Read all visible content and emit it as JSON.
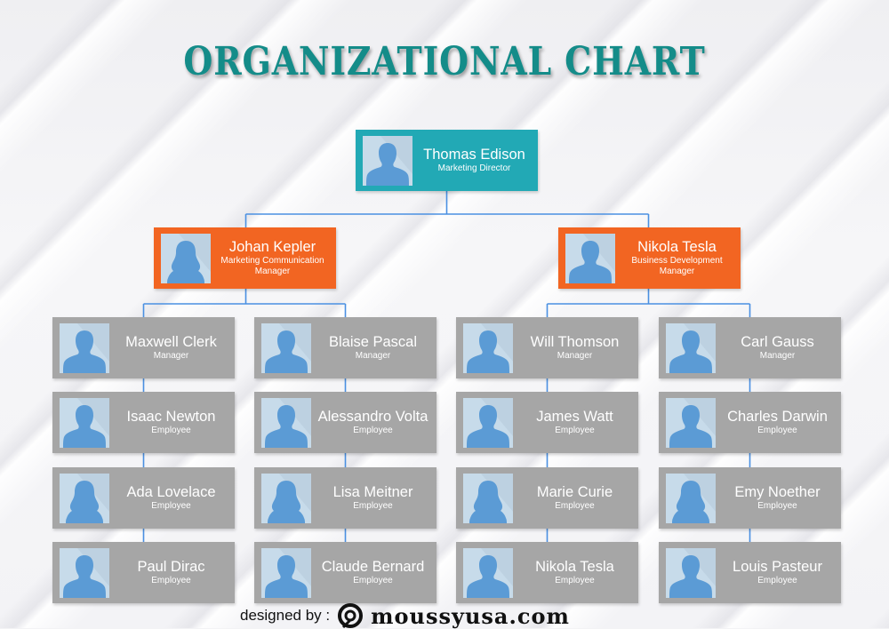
{
  "title": "ORGANIZATIONAL CHART",
  "colors": {
    "title": "#148c89",
    "director": "#22a9b5",
    "manager_lead": "#f26522",
    "staff": "#a6a6a6",
    "connector": "#4a90e2",
    "avatar_bg": "#c7dbea",
    "avatar_fill": "#5b9bd5"
  },
  "director": {
    "name": "Thomas Edison",
    "role": "Marketing Director",
    "avatar": "male-avatar-icon"
  },
  "leads": [
    {
      "name": "Johan Kepler",
      "role": "Marketing Communication Manager",
      "avatar": "female-avatar-icon"
    },
    {
      "name": "Nikola Tesla",
      "role": "Business Development Manager",
      "avatar": "male-avatar-icon"
    }
  ],
  "columns": [
    {
      "lead": 0,
      "members": [
        {
          "name": "Maxwell Clerk",
          "role": "Manager",
          "avatar": "male-avatar-icon"
        },
        {
          "name": "Isaac Newton",
          "role": "Employee",
          "avatar": "male-avatar-icon"
        },
        {
          "name": "Ada Lovelace",
          "role": "Employee",
          "avatar": "female-avatar-icon"
        },
        {
          "name": "Paul Dirac",
          "role": "Employee",
          "avatar": "male-avatar-icon"
        }
      ]
    },
    {
      "lead": 0,
      "members": [
        {
          "name": "Blaise Pascal",
          "role": "Manager",
          "avatar": "male-avatar-icon"
        },
        {
          "name": "Alessandro Volta",
          "role": "Employee",
          "avatar": "male-avatar-icon"
        },
        {
          "name": "Lisa Meitner",
          "role": "Employee",
          "avatar": "female-avatar-icon"
        },
        {
          "name": "Claude Bernard",
          "role": "Employee",
          "avatar": "male-avatar-icon"
        }
      ]
    },
    {
      "lead": 1,
      "members": [
        {
          "name": "Will Thomson",
          "role": "Manager",
          "avatar": "male-avatar-icon"
        },
        {
          "name": "James Watt",
          "role": "Employee",
          "avatar": "male-avatar-icon"
        },
        {
          "name": "Marie Curie",
          "role": "Employee",
          "avatar": "female-avatar-icon"
        },
        {
          "name": "Nikola Tesla",
          "role": "Employee",
          "avatar": "male-avatar-icon"
        }
      ]
    },
    {
      "lead": 1,
      "members": [
        {
          "name": "Carl Gauss",
          "role": "Manager",
          "avatar": "male-avatar-icon"
        },
        {
          "name": "Charles Darwin",
          "role": "Employee",
          "avatar": "male-avatar-icon"
        },
        {
          "name": "Emy Noether",
          "role": "Employee",
          "avatar": "female-avatar-icon"
        },
        {
          "name": "Louis Pasteur",
          "role": "Employee",
          "avatar": "male-avatar-icon"
        }
      ]
    }
  ],
  "footer": {
    "designed_by": "designed by :",
    "brand": "moussyusa.com",
    "logo": "moussyusa-logo-icon"
  }
}
